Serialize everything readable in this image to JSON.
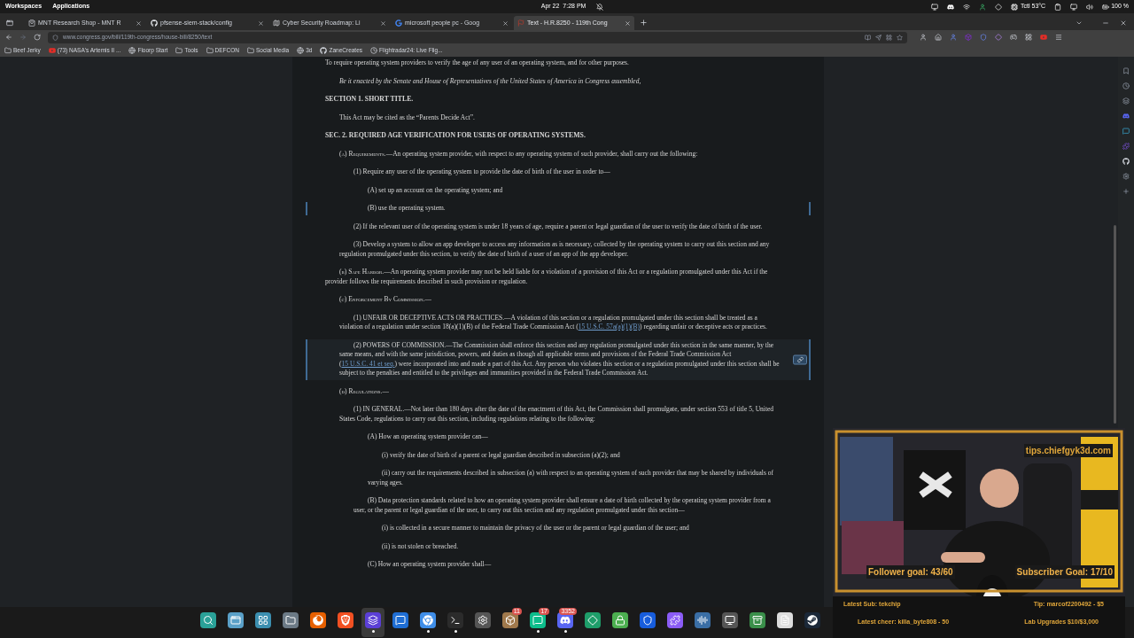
{
  "topbar": {
    "workspaces": "Workspaces",
    "applications": "Applications",
    "date": "Apr 22",
    "time": "7:28 PM",
    "temperature": "Tctl 53°C",
    "battery": "100 %"
  },
  "tabs": [
    {
      "title": "MNT Research Shop - MNT R",
      "selected": false
    },
    {
      "title": "pfsense-siem-stack/config",
      "selected": false
    },
    {
      "title": "Cyber Security Roadmap: Li",
      "selected": false
    },
    {
      "title": "microsoft people pc - Goog",
      "selected": false
    },
    {
      "title": "Text - H.R.8250 - 119th Cong",
      "selected": true
    }
  ],
  "url": "www.congress.gov/bill/119th-congress/house-bill/8250/text",
  "bookmarks": [
    {
      "label": "Beef Jerky",
      "kind": "folder"
    },
    {
      "label": "(73) NASA's Artemis II ...",
      "kind": "video"
    },
    {
      "label": "Floorp Start",
      "kind": "globe"
    },
    {
      "label": "Tools",
      "kind": "folder"
    },
    {
      "label": "DEFCON",
      "kind": "folder"
    },
    {
      "label": "Social Media",
      "kind": "folder"
    },
    {
      "label": "3d",
      "kind": "globe"
    },
    {
      "label": "ZaneCreates",
      "kind": "github"
    },
    {
      "label": "Flightradar24: Live Flig...",
      "kind": "radar"
    }
  ],
  "document": [
    {
      "kind": "purpose",
      "text": "To require operating system providers to verify the age of any user of an operating system, and for other purposes.",
      "marked": false,
      "hovered": false
    },
    {
      "kind": "enacting",
      "text": "Be it enacted by the Senate and House of Representatives of the United States of America in Congress assembled,",
      "marked": false,
      "hovered": false
    },
    {
      "kind": "heading",
      "text": "SECTION 1. SHORT TITLE.",
      "marked": false,
      "hovered": false,
      "children": [
        {
          "kind": "para",
          "text": "This Act may be cited as the “Parents Decide Act”.",
          "marked": false,
          "hovered": false
        }
      ]
    },
    {
      "kind": "heading",
      "text": "SEC. 2. REQUIRED AGE VERIFICATION FOR USERS OF OPERATING SYSTEMS.",
      "marked": false,
      "hovered": false,
      "children": [
        {
          "kind": "para",
          "label": "(a) Requirements.",
          "text": "—An operating system provider, with respect to any operating system of such provider, shall carry out the following:",
          "marked": false,
          "hovered": false,
          "children": [
            {
              "kind": "para",
              "text": "(1) Require any user of the operating system to provide the date of birth of the user in order to—",
              "marked": false,
              "hovered": false,
              "children": [
                {
                  "kind": "para",
                  "text": "(A) set up an account on the operating system; and",
                  "marked": false,
                  "hovered": false
                },
                {
                  "kind": "para",
                  "text": "(B) use the operating system.",
                  "marked": true,
                  "hovered": false
                }
              ]
            },
            {
              "kind": "para",
              "text": "(2) If the relevant user of the operating system is under 18 years of age, require a parent or legal guardian of the user to verify the date of birth of the user.",
              "marked": false,
              "hovered": false
            },
            {
              "kind": "para",
              "text": "(3) Develop a system to allow an app developer to access any information as is necessary, collected by the operating system to carry out this section and any regulation promulgated under this section, to verify the date of birth of a user of an app of the app developer.",
              "marked": false,
              "hovered": false
            }
          ]
        },
        {
          "kind": "para",
          "label": "(b) Safe Harbor.",
          "text": "—An operating system provider may not be held liable for a violation of a provision of this Act or a regulation promulgated under this Act if the provider follows the requirements described in such provision or regulation.",
          "marked": false,
          "hovered": false
        },
        {
          "kind": "para",
          "label": "(c) Enforcement By Commission.",
          "text": "—",
          "marked": false,
          "hovered": false,
          "children": [
            {
              "kind": "para",
              "parts": [
                {
                  "kind": "plain",
                  "text": "(1) UNFAIR OR DECEPTIVE ACTS OR PRACTICES.—A violation of this section or a regulation promulgated under this section shall be treated as a violation of a regulation under section 18(a)(1)(B) of the Federal Trade Commission Act ("
                },
                {
                  "kind": "link",
                  "text": "15 U.S.C. 57a(a)(1)(B)"
                },
                {
                  "kind": "plain",
                  "text": ") regarding unfair or deceptive acts or practices."
                }
              ],
              "marked": false,
              "hovered": false
            },
            {
              "kind": "para",
              "parts": [
                {
                  "kind": "plain",
                  "text": "(2) POWERS OF COMMISSION.—The Commission shall enforce this section and any regulation promulgated under this section in the same manner, by the same means, and with the same jurisdiction, powers, and duties as though all applicable terms and provisions of the Federal Trade Commission Act ("
                },
                {
                  "kind": "link",
                  "text": "15 U.S.C. 41 et seq."
                },
                {
                  "kind": "plain",
                  "text": ") were incorporated into and made a part of this Act. Any person who violates this section or a regulation promulgated under this section shall be subject to the penalties and entitled to the privileges and immunities provided in the Federal Trade Commission Act."
                }
              ],
              "marked": true,
              "hovered": true
            }
          ]
        },
        {
          "kind": "para",
          "label": "(d) Regulations.",
          "text": "—",
          "marked": false,
          "hovered": false,
          "children": [
            {
              "kind": "para",
              "text": "(1) IN GENERAL.—Not later than 180 days after the date of the enactment of this Act, the Commission shall promulgate, under section 553 of title 5, United States Code, regulations to carry out this section, including regulations relating to the following:",
              "marked": false,
              "hovered": false,
              "children": [
                {
                  "kind": "para",
                  "text": "(A) How an operating system provider can—",
                  "marked": false,
                  "hovered": false,
                  "children": [
                    {
                      "kind": "para",
                      "text": "(i) verify the date of birth of a parent or legal guardian described in subsection (a)(2); and",
                      "marked": false,
                      "hovered": false
                    },
                    {
                      "kind": "para",
                      "text": "(ii) carry out the requirements described in subsection (a) with respect to an operating system of such provider that may be shared by individuals of varying ages.",
                      "marked": false,
                      "hovered": false
                    }
                  ]
                },
                {
                  "kind": "para",
                  "text": "(B) Data protection standards related to how an operating system provider shall ensure a date of birth collected by the operating system provider from a user, or the parent or legal guardian of the user, to carry out this section and any regulation promulgated under this section—",
                  "marked": false,
                  "hovered": false,
                  "children": [
                    {
                      "kind": "para",
                      "text": "(i) is collected in a secure manner to maintain the privacy of the user or the parent or legal guardian of the user; and",
                      "marked": false,
                      "hovered": false
                    },
                    {
                      "kind": "para",
                      "text": "(ii) is not stolen or breached.",
                      "marked": false,
                      "hovered": false
                    }
                  ]
                },
                {
                  "kind": "para",
                  "text": "(C) How an operating system provider shall—",
                  "marked": false,
                  "hovered": false
                }
              ]
            }
          ]
        }
      ]
    }
  ],
  "stream_overlay": {
    "tips": "tips.chiefgyk3d.com",
    "follower_goal": "Follower goal: 43/60",
    "subscriber_goal": "Subscriber Goal: 17/10",
    "latest_sub": "Latest Sub: tekchip",
    "tip": "Tip: marcof2200492 - $5",
    "latest_cheer": "Latest cheer: killa_byte808 - 50",
    "lab_upgrades": "Lab Upgrades $10/$3,000"
  },
  "taskbar": [
    {
      "selected": false,
      "running": false
    },
    {
      "selected": false,
      "running": false
    },
    {
      "selected": false,
      "running": false
    },
    {
      "selected": false,
      "running": false
    },
    {
      "selected": false,
      "running": false
    },
    {
      "selected": false,
      "running": false
    },
    {
      "selected": true,
      "running": true
    },
    {
      "selected": false,
      "running": false
    },
    {
      "selected": false,
      "running": true
    },
    {
      "selected": false,
      "running": true
    },
    {
      "selected": false,
      "running": false
    },
    {
      "selected": false,
      "running": false,
      "badge": "11"
    },
    {
      "selected": false,
      "running": true,
      "badge": "17"
    },
    {
      "selected": false,
      "running": true,
      "badge": "3352"
    },
    {
      "selected": false,
      "running": false
    },
    {
      "selected": false,
      "running": false
    },
    {
      "selected": false,
      "running": false
    },
    {
      "selected": false,
      "running": false
    },
    {
      "selected": false,
      "running": false
    },
    {
      "selected": false,
      "running": false
    },
    {
      "selected": false,
      "running": false
    },
    {
      "selected": false,
      "running": false
    },
    {
      "selected": false,
      "running": false
    }
  ]
}
